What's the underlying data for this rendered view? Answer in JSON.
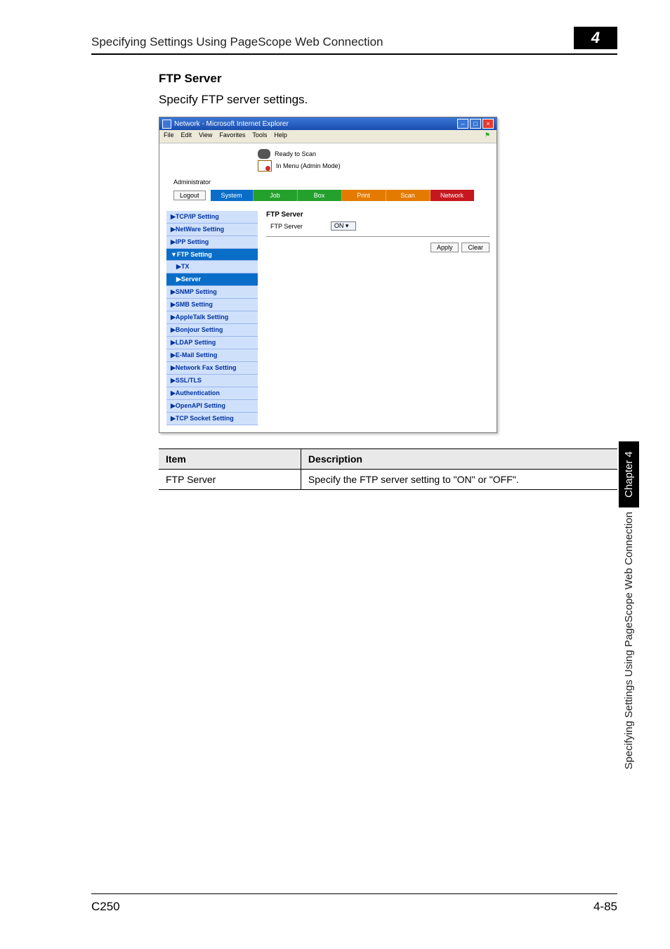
{
  "header": {
    "running_title": "Specifying Settings Using PageScope Web Connection",
    "chapter_number": "4"
  },
  "section": {
    "heading": "FTP Server",
    "lead": "Specify FTP server settings."
  },
  "shot": {
    "window_title": "Network - Microsoft Internet Explorer",
    "menubar": [
      "File",
      "Edit",
      "View",
      "Favorites",
      "Tools",
      "Help"
    ],
    "status_primary": "Ready to Scan",
    "status_secondary": "In Menu (Admin Mode)",
    "admin_label": "Administrator",
    "logout_label": "Logout",
    "tabs": {
      "system": "System",
      "job": "Job",
      "box": "Box",
      "print": "Print",
      "scan": "Scan",
      "network": "Network"
    },
    "sidebar_items": [
      {
        "label": "▶TCP/IP Setting",
        "selected": false
      },
      {
        "label": "▶NetWare Setting",
        "selected": false
      },
      {
        "label": "▶IPP Setting",
        "selected": false
      },
      {
        "label": "▼FTP Setting",
        "selected": true
      },
      {
        "label": "▶TX",
        "selected": false,
        "sub": true
      },
      {
        "label": "▶Server",
        "selected": true,
        "sub": true
      },
      {
        "label": "▶SNMP Setting",
        "selected": false
      },
      {
        "label": "▶SMB Setting",
        "selected": false
      },
      {
        "label": "▶AppleTalk Setting",
        "selected": false
      },
      {
        "label": "▶Bonjour Setting",
        "selected": false
      },
      {
        "label": "▶LDAP Setting",
        "selected": false
      },
      {
        "label": "▶E-Mail Setting",
        "selected": false
      },
      {
        "label": "▶Network Fax Setting",
        "selected": false
      },
      {
        "label": "▶SSL/TLS",
        "selected": false
      },
      {
        "label": "▶Authentication",
        "selected": false
      },
      {
        "label": "▶OpenAPI Setting",
        "selected": false
      },
      {
        "label": "▶TCP Socket Setting",
        "selected": false
      }
    ],
    "pane": {
      "title": "FTP Server",
      "row_label": "FTP Server",
      "select_value": "ON",
      "apply": "Apply",
      "clear": "Clear"
    }
  },
  "table": {
    "head_item": "Item",
    "head_desc": "Description",
    "rows": [
      {
        "item": "FTP Server",
        "desc": "Specify the FTP server setting to \"ON\" or \"OFF\"."
      }
    ]
  },
  "side_tab": {
    "chapter": "Chapter 4",
    "running": "Specifying Settings Using PageScope Web Connection"
  },
  "footer": {
    "left": "C250",
    "right": "4-85"
  }
}
